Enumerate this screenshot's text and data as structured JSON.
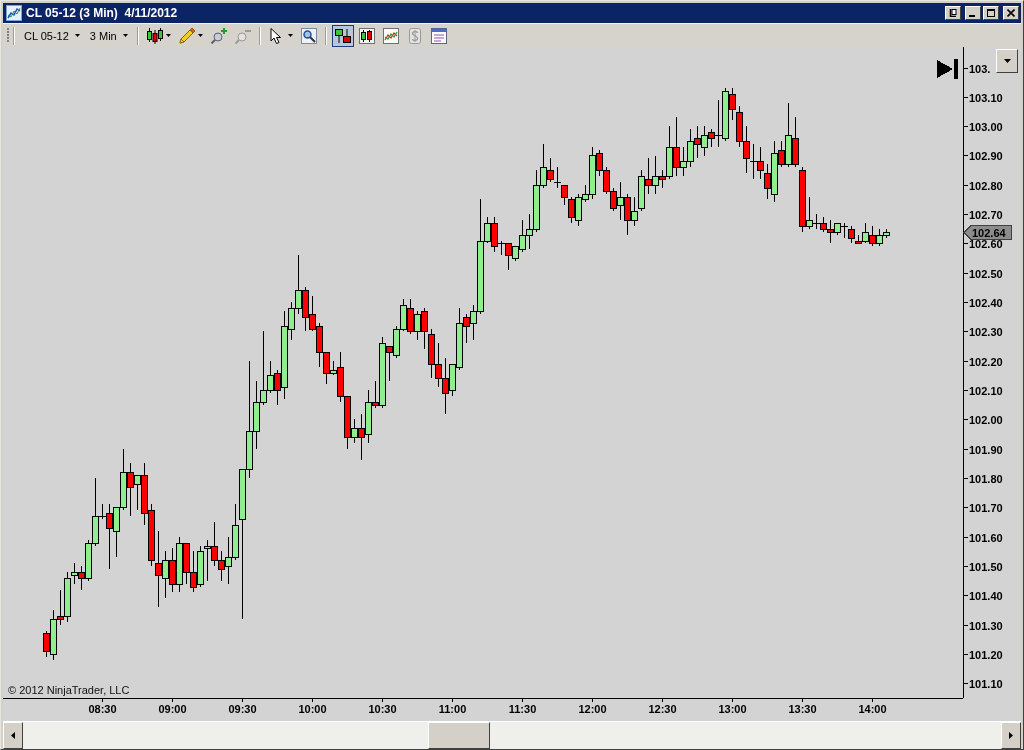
{
  "window": {
    "title": "CL 05-12 (3 Min)  4/11/2012"
  },
  "toolbar": {
    "selectors": [
      {
        "label": "CL 05-12"
      },
      {
        "label": "3 Min"
      }
    ],
    "tool_groups": [
      [
        {
          "kind": "menu",
          "selected": false,
          "disabled": false
        },
        {
          "kind": "menu",
          "selected": false,
          "disabled": false
        },
        {
          "kind": "button",
          "selected": false,
          "disabled": false
        },
        {
          "kind": "button",
          "selected": false,
          "disabled": true
        }
      ],
      [
        {
          "kind": "menu",
          "selected": false,
          "disabled": false
        },
        {
          "kind": "button",
          "selected": false,
          "disabled": false
        }
      ],
      [
        {
          "kind": "button",
          "selected": true,
          "disabled": false
        },
        {
          "kind": "button",
          "selected": false,
          "disabled": false
        },
        {
          "kind": "button",
          "selected": false,
          "disabled": false
        },
        {
          "kind": "button",
          "selected": false,
          "disabled": true
        },
        {
          "kind": "button",
          "selected": false,
          "disabled": false
        }
      ]
    ]
  },
  "chart": {
    "copyright": "© 2012 NinjaTrader, LLC",
    "last_price": "102.64",
    "chart_data": [
      {
        "type": "candlestick",
        "xlim": [
          7.79,
          14.65
        ],
        "ylim": [
          101.05,
          103.27
        ],
        "xticks": [
          {
            "value": 8.5,
            "label": "08:30"
          },
          {
            "value": 9,
            "label": "09:00"
          },
          {
            "value": 9.5,
            "label": "09:30"
          },
          {
            "value": 10,
            "label": "10:00"
          },
          {
            "value": 10.5,
            "label": "10:30"
          },
          {
            "value": 11,
            "label": "11:00"
          },
          {
            "value": 11.5,
            "label": "11:30"
          },
          {
            "value": 12,
            "label": "12:00"
          },
          {
            "value": 12.5,
            "label": "12:30"
          },
          {
            "value": 13,
            "label": "13:00"
          },
          {
            "value": 13.5,
            "label": "13:30"
          },
          {
            "value": 14,
            "label": "14:00"
          }
        ],
        "yticks": [
          {
            "value": 101.1,
            "label": "101.10"
          },
          {
            "value": 101.2,
            "label": "101.20"
          },
          {
            "value": 101.3,
            "label": "101.30"
          },
          {
            "value": 101.4,
            "label": "101.40"
          },
          {
            "value": 101.5,
            "label": "101.50"
          },
          {
            "value": 101.6,
            "label": "101.60"
          },
          {
            "value": 101.7,
            "label": "101.70"
          },
          {
            "value": 101.8,
            "label": "101.80"
          },
          {
            "value": 101.9,
            "label": "101.90"
          },
          {
            "value": 102,
            "label": "102.00"
          },
          {
            "value": 102.1,
            "label": "102.10"
          },
          {
            "value": 102.2,
            "label": "102.20"
          },
          {
            "value": 102.3,
            "label": "102.30"
          },
          {
            "value": 102.4,
            "label": "102.40"
          },
          {
            "value": 102.5,
            "label": "102.50"
          },
          {
            "value": 102.6,
            "label": "102.60"
          },
          {
            "value": 102.7,
            "label": "102.70"
          },
          {
            "value": 102.8,
            "label": "102.80"
          },
          {
            "value": 102.9,
            "label": "102.90"
          },
          {
            "value": 103,
            "label": "103.00"
          },
          {
            "value": 103.1,
            "label": "103.10"
          },
          {
            "value": 103.2,
            "label": "103."
          }
        ],
        "x": [
          8.1,
          8.15,
          8.2,
          8.25,
          8.3,
          8.35,
          8.4,
          8.45,
          8.5,
          8.55,
          8.6,
          8.65,
          8.7,
          8.75,
          8.8,
          8.85,
          8.9,
          8.95,
          9,
          9.05,
          9.1,
          9.15,
          9.2,
          9.25,
          9.3,
          9.35,
          9.4,
          9.45,
          9.5,
          9.55,
          9.6,
          9.65,
          9.7,
          9.75,
          9.8,
          9.85,
          9.9,
          9.95,
          10,
          10.05,
          10.1,
          10.15,
          10.2,
          10.25,
          10.3,
          10.35,
          10.4,
          10.45,
          10.5,
          10.55,
          10.6,
          10.65,
          10.7,
          10.75,
          10.8,
          10.85,
          10.9,
          10.95,
          11,
          11.05,
          11.1,
          11.15,
          11.2,
          11.25,
          11.3,
          11.35,
          11.4,
          11.45,
          11.5,
          11.55,
          11.6,
          11.65,
          11.7,
          11.75,
          11.8,
          11.85,
          11.9,
          11.95,
          12,
          12.05,
          12.1,
          12.15,
          12.2,
          12.25,
          12.3,
          12.35,
          12.4,
          12.45,
          12.5,
          12.55,
          12.6,
          12.65,
          12.7,
          12.75,
          12.8,
          12.85,
          12.9,
          12.95,
          13,
          13.05,
          13.1,
          13.15,
          13.2,
          13.25,
          13.3,
          13.35,
          13.4,
          13.45,
          13.5,
          13.55,
          13.6,
          13.65,
          13.7,
          13.75,
          13.8,
          13.85,
          13.9,
          13.95,
          14,
          14.05,
          14.1
        ],
        "ohlc": [
          [
            101.27,
            101.28,
            101.19,
            101.21
          ],
          [
            101.2,
            101.35,
            101.18,
            101.32
          ],
          [
            101.33,
            101.42,
            101.3,
            101.32
          ],
          [
            101.33,
            101.48,
            101.31,
            101.46
          ],
          [
            101.47,
            101.51,
            101.44,
            101.48
          ],
          [
            101.48,
            101.5,
            101.42,
            101.46
          ],
          [
            101.46,
            101.59,
            101.45,
            101.58
          ],
          [
            101.58,
            101.8,
            101.57,
            101.67
          ],
          [
            101.67,
            101.71,
            101.66,
            101.67
          ],
          [
            101.68,
            101.71,
            101.49,
            101.63
          ],
          [
            101.62,
            101.7,
            101.53,
            101.7
          ],
          [
            101.7,
            101.9,
            101.69,
            101.82
          ],
          [
            101.82,
            101.85,
            101.67,
            101.77
          ],
          [
            101.78,
            101.81,
            101.69,
            101.81
          ],
          [
            101.81,
            101.85,
            101.64,
            101.68
          ],
          [
            101.69,
            101.71,
            101.5,
            101.52
          ],
          [
            101.51,
            101.62,
            101.36,
            101.47
          ],
          [
            101.46,
            101.55,
            101.39,
            101.52
          ],
          [
            101.52,
            101.56,
            101.41,
            101.44
          ],
          [
            101.44,
            101.6,
            101.41,
            101.58
          ],
          [
            101.58,
            101.58,
            101.44,
            101.48
          ],
          [
            101.48,
            101.55,
            101.41,
            101.43
          ],
          [
            101.44,
            101.57,
            101.43,
            101.55
          ],
          [
            101.56,
            101.59,
            101.45,
            101.57
          ],
          [
            101.57,
            101.65,
            101.5,
            101.52
          ],
          [
            101.52,
            101.55,
            101.45,
            101.49
          ],
          [
            101.5,
            101.6,
            101.44,
            101.53
          ],
          [
            101.53,
            101.71,
            101.52,
            101.64
          ],
          [
            101.66,
            101.83,
            101.32,
            101.83
          ],
          [
            101.83,
            102.2,
            101.8,
            101.96
          ],
          [
            101.96,
            102.13,
            101.9,
            102.06
          ],
          [
            102.06,
            102.3,
            102.05,
            102.1
          ],
          [
            102.1,
            102.2,
            102.09,
            102.15
          ],
          [
            102.16,
            102.17,
            102.05,
            102.1
          ],
          [
            102.11,
            102.37,
            102.07,
            102.32
          ],
          [
            102.31,
            102.4,
            102.27,
            102.38
          ],
          [
            102.38,
            102.56,
            102.36,
            102.44
          ],
          [
            102.44,
            102.45,
            102.3,
            102.35
          ],
          [
            102.36,
            102.42,
            102.3,
            102.31
          ],
          [
            102.32,
            102.33,
            102.18,
            102.23
          ],
          [
            102.23,
            102.23,
            102.12,
            102.16
          ],
          [
            102.16,
            102.2,
            102.15,
            102.17
          ],
          [
            102.18,
            102.23,
            102.06,
            102.08
          ],
          [
            102.08,
            102.08,
            101.9,
            101.94
          ],
          [
            101.94,
            102,
            101.92,
            101.97
          ],
          [
            101.97,
            102.02,
            101.86,
            101.94
          ],
          [
            101.95,
            102.1,
            101.92,
            102.06
          ],
          [
            102.06,
            102.13,
            102.04,
            102.05
          ],
          [
            102.05,
            102.28,
            102.04,
            102.26
          ],
          [
            102.25,
            102.25,
            102.13,
            102.23
          ],
          [
            102.22,
            102.32,
            102.21,
            102.31
          ],
          [
            102.31,
            102.41,
            102.3,
            102.39
          ],
          [
            102.38,
            102.41,
            102.29,
            102.3
          ],
          [
            102.3,
            102.37,
            102.27,
            102.36
          ],
          [
            102.37,
            102.38,
            102.24,
            102.3
          ],
          [
            102.29,
            102.31,
            102.14,
            102.19
          ],
          [
            102.19,
            102.26,
            102.11,
            102.14
          ],
          [
            102.14,
            102.21,
            102.02,
            102.09
          ],
          [
            102.1,
            102.19,
            102.08,
            102.19
          ],
          [
            102.18,
            102.38,
            102.17,
            102.33
          ],
          [
            102.35,
            102.36,
            102.26,
            102.32
          ],
          [
            102.33,
            102.39,
            102.27,
            102.37
          ],
          [
            102.37,
            102.75,
            102.36,
            102.61
          ],
          [
            102.61,
            102.69,
            102.6,
            102.67
          ],
          [
            102.67,
            102.69,
            102.57,
            102.59
          ],
          [
            102.6,
            102.61,
            102.56,
            102.6
          ],
          [
            102.6,
            102.6,
            102.51,
            102.56
          ],
          [
            102.55,
            102.59,
            102.54,
            102.59
          ],
          [
            102.58,
            102.68,
            102.57,
            102.63
          ],
          [
            102.63,
            102.7,
            102.58,
            102.65
          ],
          [
            102.65,
            102.85,
            102.64,
            102.8
          ],
          [
            102.8,
            102.94,
            102.79,
            102.86
          ],
          [
            102.85,
            102.89,
            102.81,
            102.82
          ],
          [
            102.81,
            102.86,
            102.79,
            102.81
          ],
          [
            102.8,
            102.8,
            102.73,
            102.76
          ],
          [
            102.75,
            102.76,
            102.67,
            102.69
          ],
          [
            102.68,
            102.77,
            102.66,
            102.76
          ],
          [
            102.75,
            102.8,
            102.74,
            102.77
          ],
          [
            102.77,
            102.93,
            102.75,
            102.9
          ],
          [
            102.91,
            102.92,
            102.83,
            102.85
          ],
          [
            102.85,
            102.86,
            102.77,
            102.78
          ],
          [
            102.78,
            102.79,
            102.71,
            102.72
          ],
          [
            102.73,
            102.81,
            102.68,
            102.76
          ],
          [
            102.76,
            102.77,
            102.63,
            102.68
          ],
          [
            102.68,
            102.76,
            102.66,
            102.71
          ],
          [
            102.72,
            102.85,
            102.71,
            102.83
          ],
          [
            102.82,
            102.89,
            102.77,
            102.8
          ],
          [
            102.8,
            102.9,
            102.77,
            102.83
          ],
          [
            102.83,
            102.85,
            102.79,
            102.82
          ],
          [
            102.83,
            103,
            102.82,
            102.93
          ],
          [
            102.93,
            103.03,
            102.83,
            102.86
          ],
          [
            102.86,
            102.93,
            102.83,
            102.88
          ],
          [
            102.88,
            102.99,
            102.86,
            102.95
          ],
          [
            102.96,
            103,
            102.89,
            102.94
          ],
          [
            102.93,
            103,
            102.9,
            102.97
          ],
          [
            102.98,
            102.99,
            102.93,
            102.96
          ],
          [
            102.97,
            103.09,
            102.93,
            102.97
          ],
          [
            102.96,
            103.13,
            102.95,
            103.12
          ],
          [
            103.11,
            103.13,
            103.02,
            103.06
          ],
          [
            103.05,
            103.07,
            102.93,
            102.95
          ],
          [
            102.95,
            103,
            102.84,
            102.89
          ],
          [
            102.88,
            102.94,
            102.82,
            102.88
          ],
          [
            102.88,
            102.93,
            102.82,
            102.85
          ],
          [
            102.84,
            102.87,
            102.75,
            102.79
          ],
          [
            102.77,
            102.95,
            102.74,
            102.91
          ],
          [
            102.92,
            102.95,
            102.86,
            102.87
          ],
          [
            102.87,
            103.08,
            102.86,
            102.97
          ],
          [
            102.96,
            103.03,
            102.86,
            102.87
          ],
          [
            102.85,
            102.86,
            102.64,
            102.66
          ],
          [
            102.66,
            102.76,
            102.65,
            102.68
          ],
          [
            102.67,
            102.7,
            102.65,
            102.67
          ],
          [
            102.67,
            102.69,
            102.64,
            102.65
          ],
          [
            102.65,
            102.68,
            102.6,
            102.64
          ],
          [
            102.64,
            102.67,
            102.63,
            102.67
          ],
          [
            102.66,
            102.67,
            102.62,
            102.66
          ],
          [
            102.65,
            102.66,
            102.6,
            102.62
          ],
          [
            102.61,
            102.63,
            102.6,
            102.6
          ],
          [
            102.61,
            102.67,
            102.6,
            102.64
          ],
          [
            102.63,
            102.66,
            102.59,
            102.6
          ],
          [
            102.6,
            102.65,
            102.59,
            102.63
          ],
          [
            102.63,
            102.65,
            102.62,
            102.64
          ]
        ]
      }
    ]
  }
}
